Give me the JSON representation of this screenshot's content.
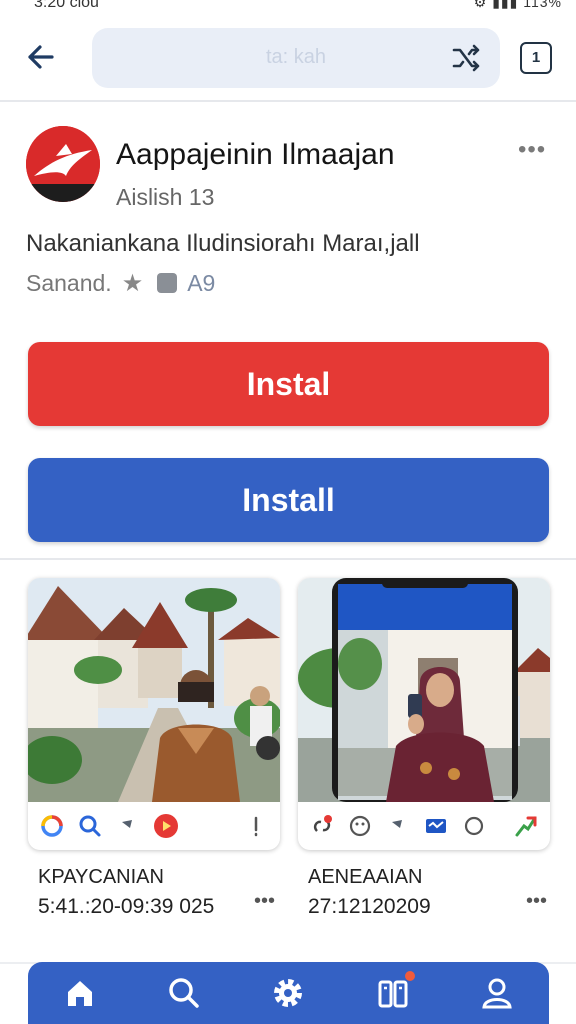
{
  "status_bar": {
    "time": "3:20 clou",
    "icons": "⚙ ▮▮▮ 113%"
  },
  "top_bar": {
    "url_text": "ta: kah",
    "tabs_count": "1"
  },
  "app": {
    "title": "Aappajeinin Ilmaajan",
    "subtitle": "Aislish 13",
    "description": "Nakaniankana Iludinsiorahı Maraı,jall",
    "rating_label": "Sanand.",
    "age_rating": "A9",
    "icon_color": "#d92a2a"
  },
  "buttons": {
    "primary_red_label": "Instal",
    "primary_blue_label": "Install",
    "red_color": "#e53935",
    "blue_color": "#3461c4"
  },
  "screenshots": [
    {
      "title": "KPAYCANIAN",
      "subtitle": "5:41.:20-09:39 025"
    },
    {
      "title": "AENEAAIAN",
      "subtitle": "27:12120209"
    }
  ],
  "more_icon": "•••",
  "bottom_nav": {
    "items": [
      "home-icon",
      "search-icon",
      "settings-icon",
      "library-icon",
      "profile-icon"
    ]
  }
}
